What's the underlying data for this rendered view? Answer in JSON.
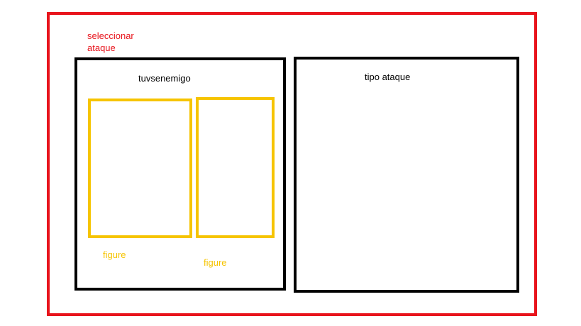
{
  "section": {
    "title": "seleccionar ataque"
  },
  "enemy_panel": {
    "label": "tuvsenemigo",
    "figures": [
      {
        "label": "figure"
      },
      {
        "label": "figure"
      }
    ]
  },
  "attack_panel": {
    "label": "tipo ataque"
  },
  "colors": {
    "outer_frame": "#e8141c",
    "panel_border": "#000000",
    "figure_border": "#f6c400"
  }
}
